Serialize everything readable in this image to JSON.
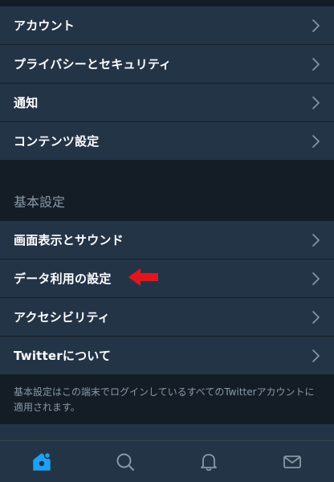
{
  "group_top": {
    "items": [
      {
        "label": "アカウント"
      },
      {
        "label": "プライバシーとセキュリティ"
      },
      {
        "label": "通知"
      },
      {
        "label": "コンテンツ設定"
      }
    ]
  },
  "basic": {
    "title": "基本設定",
    "items": [
      {
        "label": "画面表示とサウンド"
      },
      {
        "label": "データ利用の設定"
      },
      {
        "label": "アクセシビリティ"
      },
      {
        "label": "Twitterについて"
      }
    ],
    "footnote": "基本設定はこの端末でログインしているすべてのTwitterアカウントに適用されます。"
  },
  "tabbar": {
    "tabs": [
      {
        "icon": "home-icon",
        "active": true
      },
      {
        "icon": "search-icon",
        "active": false
      },
      {
        "icon": "bell-icon",
        "active": false
      },
      {
        "icon": "mail-icon",
        "active": false
      }
    ]
  },
  "colors": {
    "background": "#141d26",
    "row_background": "#243447",
    "accent": "#1da1f2",
    "muted_text": "#8899a6",
    "annotation_arrow": "#e0161f"
  }
}
